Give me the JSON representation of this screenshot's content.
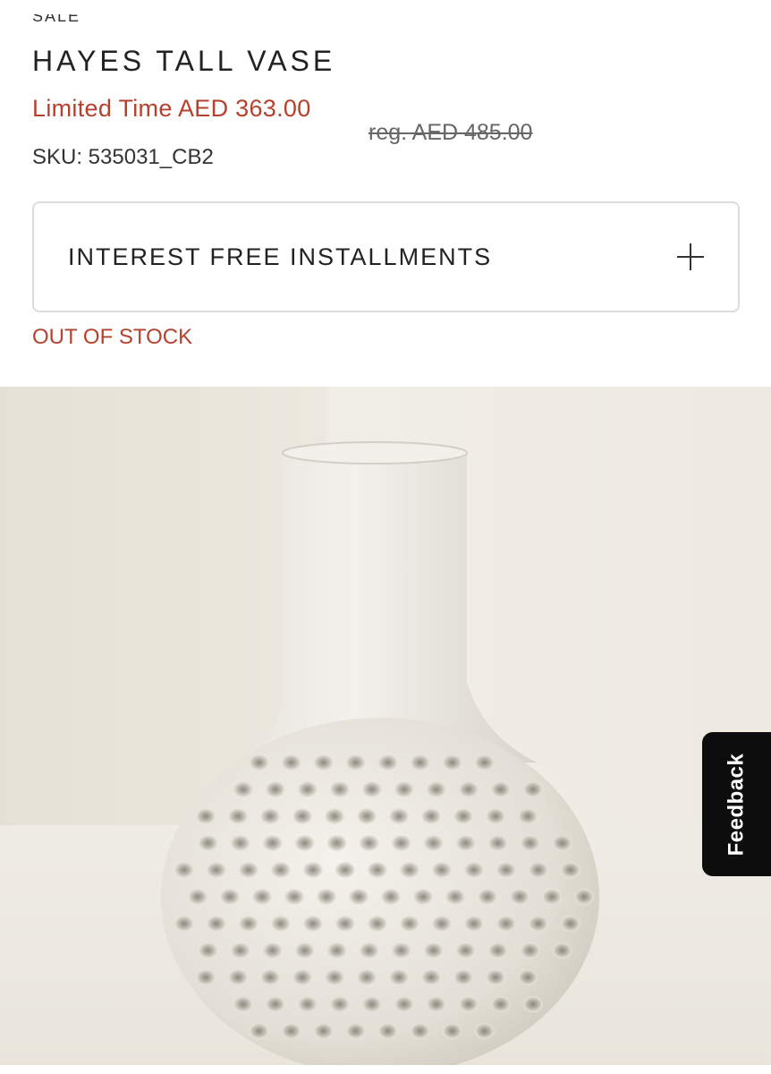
{
  "product": {
    "sale_tag": "SALE",
    "title": "HAYES TALL VASE",
    "sale_price": "Limited Time AED 363.00",
    "regular_price": "reg. AED 485.00",
    "sku": "SKU: 535031_CB2",
    "stock_status": "OUT OF STOCK"
  },
  "installments": {
    "label": "INTEREST FREE INSTALLMENTS",
    "icon": "plus-icon"
  },
  "image": {
    "subject": "white textured ceramic vase"
  },
  "feedback": {
    "label": "Feedback"
  },
  "colors": {
    "accent_red": "#b5412d",
    "text": "#222222",
    "border": "#dcdcdc",
    "feedback_bg": "#0d0d0d"
  }
}
